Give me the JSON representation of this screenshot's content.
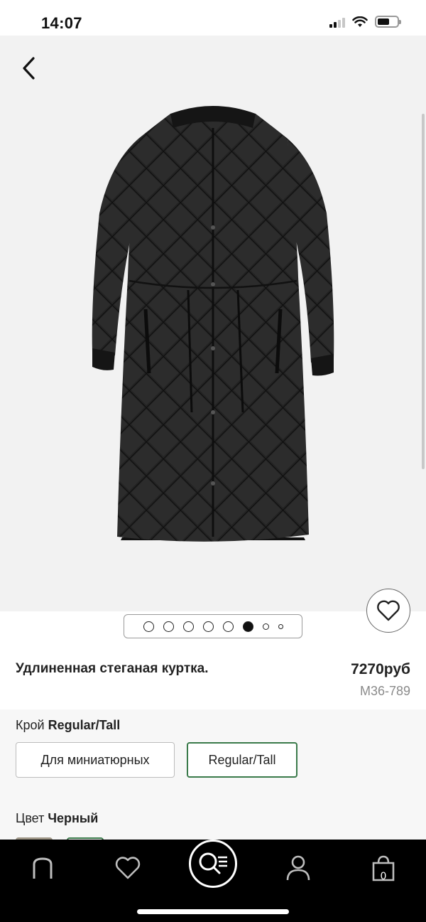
{
  "status_bar": {
    "time": "14:07"
  },
  "product": {
    "title": "Удлиненная стеганая куртка.",
    "price": "7270руб",
    "code": "M36-789"
  },
  "gallery": {
    "image_count": 8,
    "active_index": 5
  },
  "fit": {
    "label": "Крой",
    "selected": "Regular/Tall",
    "options": [
      "Для миниатюрных",
      "Regular/Tall"
    ]
  },
  "colour": {
    "label": "Цвет",
    "selected": "Черный"
  },
  "tabbar": {
    "bag_count": "0"
  },
  "icons": [
    "back-arrow-icon",
    "wishlist-heart-icon",
    "home-logo-icon",
    "favourites-heart-icon",
    "search-icon",
    "account-icon",
    "shopping-bag-icon"
  ],
  "colors": {
    "accent_green": "#3a7a4a",
    "tabbar_bg": "#000000",
    "gallery_bg": "#f2f2f2"
  }
}
